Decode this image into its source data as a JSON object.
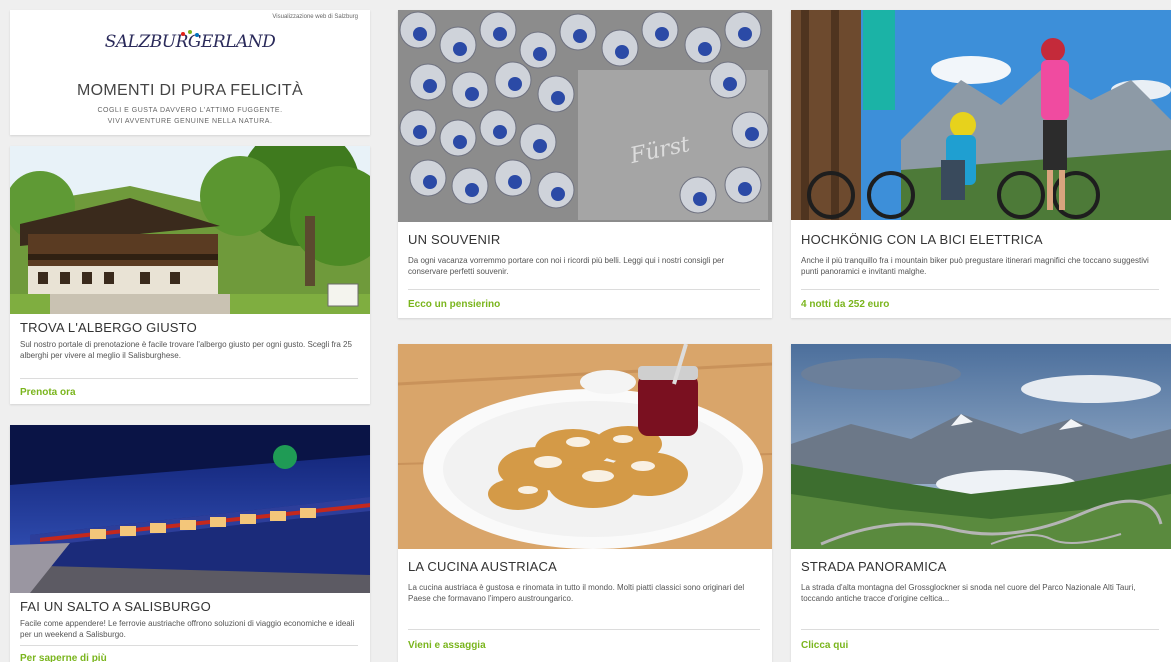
{
  "header": {
    "top_note": "Visualizzazione web di Salzburg",
    "logo_text": "SALZBURGERLAND",
    "headline": "MOMENTI DI PURA FELICITÀ",
    "subline_1": "COGLI E GUSTA DAVVERO L'ATTIMO FUGGENTE.",
    "subline_2": "VIVI AVVENTURE GENUINE NELLA NATURA."
  },
  "cards": {
    "hotel": {
      "title": "TROVA L'ALBERGO GIUSTO",
      "text": "Sul nostro portale di prenotazione è facile trovare l'albergo giusto per ogni gusto. Scegli fra 25 alberghi per vivere al meglio il Salisburghese.",
      "link": "Prenota ora"
    },
    "train": {
      "title": "FAI UN SALTO A SALISBURGO",
      "text": "Facile come appendere! Le ferrovie austriache offrono soluzioni di viaggio economiche e ideali per un weekend a Salisburgo.",
      "link": "Per saperne di più"
    },
    "souvenir": {
      "title": "UN SOUVENIR",
      "text": "Da ogni vacanza vorremmo portare con noi i ricordi più belli. Leggi qui i nostri consigli per conservare perfetti souvenir.",
      "link": "Ecco un pensierino",
      "wrapper_text": "Fürst"
    },
    "bike": {
      "title": "HOCHKÖNIG CON LA BICI ELETTRICA",
      "text": "Anche il più tranquillo fra i mountain biker può pregustare itinerari magnifici che toccano suggestivi punti panoramici e invitanti malghe.",
      "link": "4 notti da 252 euro"
    },
    "cucina": {
      "title": "LA CUCINA AUSTRIACA",
      "text": "La cucina austriaca è gustosa e rinomata in tutto il mondo. Molti piatti classici sono originari del Paese che formavano l'impero austroungarico.",
      "link": "Vieni e assaggia"
    },
    "strada": {
      "title": "STRADA PANORAMICA",
      "text": "La strada d'alta montagna del Grossglockner si snoda nel cuore del Parco Nazionale Alti Tauri, toccando antiche tracce d'origine celtica...",
      "link": "Clicca qui"
    }
  },
  "colors": {
    "link_green": "#7ab51d",
    "logo_navy": "#2a2a5a",
    "page_bg": "#efefef"
  }
}
